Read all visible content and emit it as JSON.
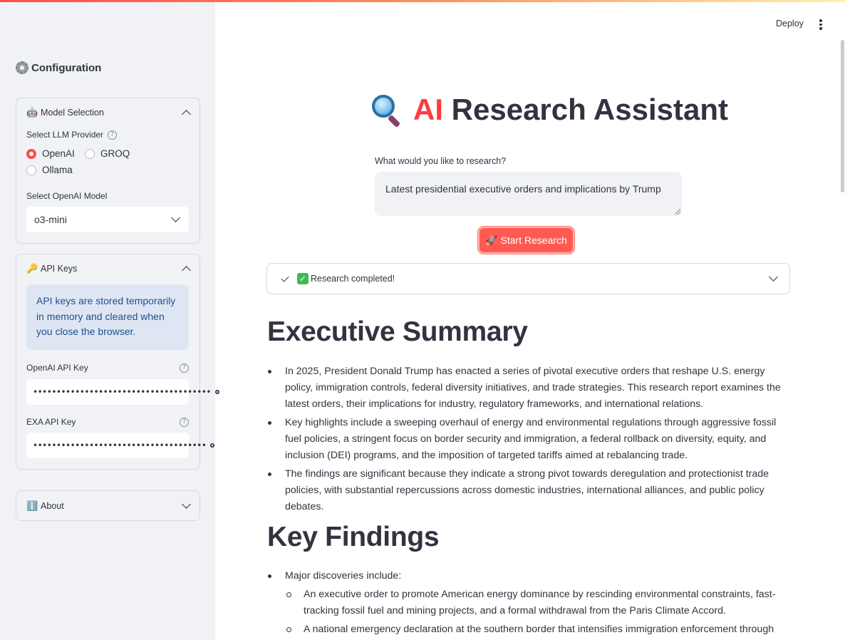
{
  "header": {
    "deploy_label": "Deploy"
  },
  "sidebar": {
    "title": "Configuration",
    "model_panel": {
      "title": "Model Selection",
      "emoji": "🤖",
      "provider_label": "Select LLM Provider",
      "providers": [
        "OpenAI",
        "GROQ",
        "Ollama"
      ],
      "selected_provider": "OpenAI",
      "model_label": "Select OpenAI Model",
      "model_value": "o3-mini"
    },
    "keys_panel": {
      "title": "API Keys",
      "emoji": "🔑",
      "info": "API keys are stored temporarily in memory and cleared when you close the browser.",
      "openai_label": "OpenAI API Key",
      "openai_value": "••••••••••••••••••••••••••••••••••••••",
      "exa_label": "EXA API Key",
      "exa_value": "•••••••••••••••••••••••••••••••••••••"
    },
    "about_panel": {
      "title": "About",
      "emoji": "ℹ️"
    }
  },
  "main": {
    "title_ai": "AI",
    "title_rest": "Research Assistant",
    "query_label": "What would you like to research?",
    "query_value": "Latest presidential executive orders and implications by Trump",
    "start_button": "Start Research",
    "start_emoji": "🚀",
    "status_text": "Research completed!",
    "sections": [
      {
        "heading": "Executive Summary",
        "items": [
          "In 2025, President Donald Trump has enacted a series of pivotal executive orders that reshape U.S. energy policy, immigration controls, federal diversity initiatives, and trade strategies. This research report examines the latest orders, their implications for industry, regulatory frameworks, and international relations.",
          "Key highlights include a sweeping overhaul of energy and environmental regulations through aggressive fossil fuel policies, a stringent focus on border security and immigration, a federal rollback on diversity, equity, and inclusion (DEI) programs, and the imposition of targeted tariffs aimed at rebalancing trade.",
          "The findings are significant because they indicate a strong pivot towards deregulation and protectionist trade policies, with substantial repercussions across domestic industries, international alliances, and public policy debates."
        ]
      },
      {
        "heading": "Key Findings",
        "intro": "Major discoveries include:",
        "subitems": [
          "An executive order to promote American energy dominance by rescinding environmental constraints, fast-tracking fossil fuel and mining projects, and a formal withdrawal from the Paris Climate Accord.",
          "A national emergency declaration at the southern border that intensifies immigration enforcement through"
        ]
      }
    ]
  },
  "colors": {
    "accent": "#ff4b4b",
    "sidebar_bg": "#f0f2f6",
    "info_text": "#1c4f8c",
    "info_bg": "#dfe6f3"
  }
}
